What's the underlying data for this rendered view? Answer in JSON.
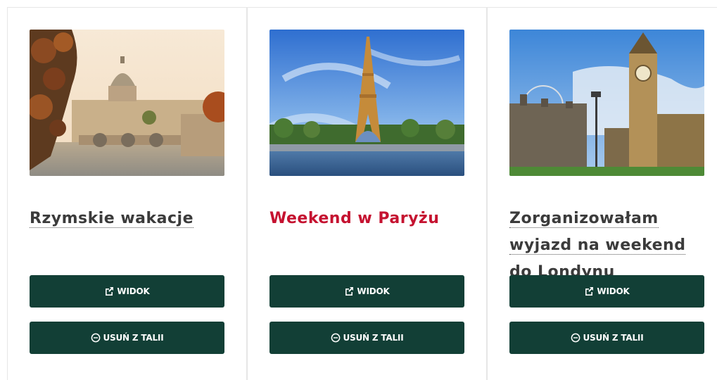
{
  "cards": [
    {
      "title": "Rzymskie wakacje",
      "image": "rome-vatican-photo",
      "view_label": "WIDOK",
      "remove_label": "USUŃ Z TALII",
      "active": false
    },
    {
      "title": "Weekend w Paryżu",
      "image": "paris-eiffel-tower-photo",
      "view_label": "WIDOK",
      "remove_label": "USUŃ Z TALII",
      "active": true
    },
    {
      "title": "Zorganizowałam wyjazd na weekend do Londynu",
      "image": "london-big-ben-photo",
      "view_label": "WIDOK",
      "remove_label": "USUŃ Z TALII",
      "active": false
    }
  ],
  "icons": {
    "view": "external-link-icon",
    "remove": "minus-circle-icon"
  },
  "colors": {
    "button_bg": "#123f36",
    "button_text": "#ffffff",
    "title_text": "#3b3b3b",
    "title_active": "#c51230"
  }
}
